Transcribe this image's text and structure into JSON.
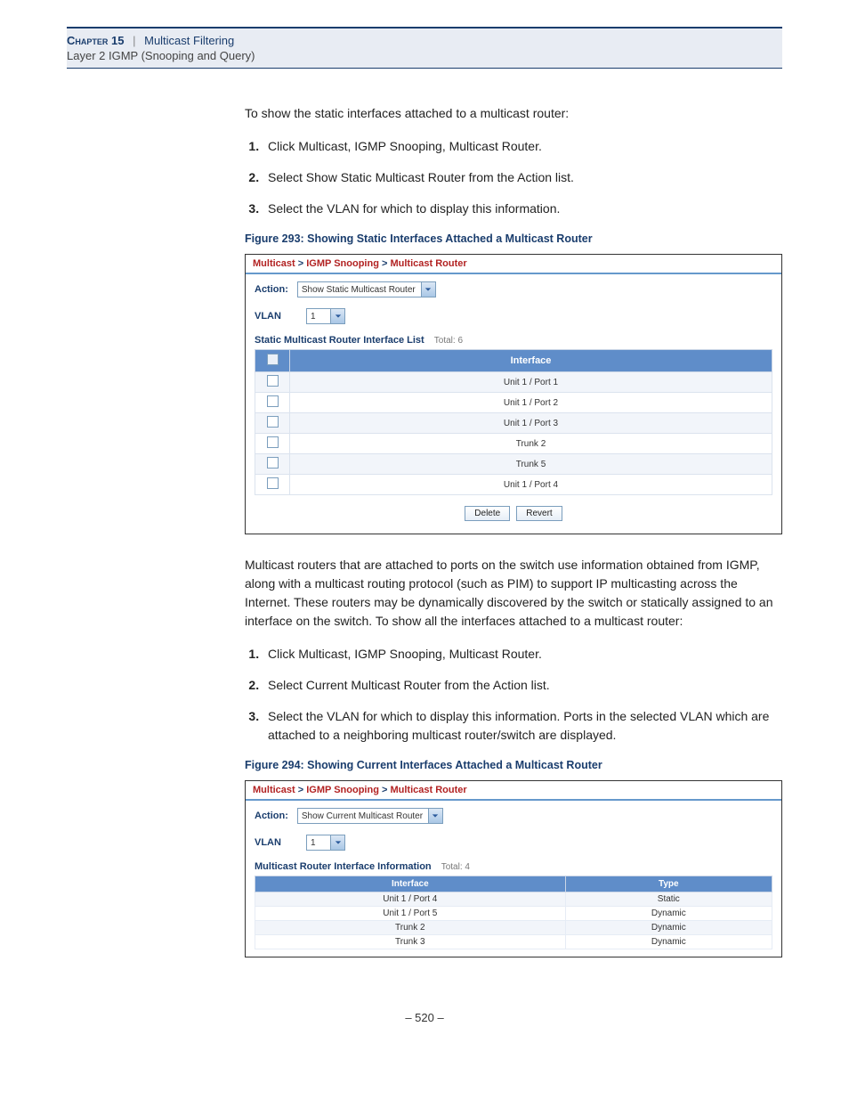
{
  "header": {
    "chapter": "Chapter 15",
    "section": "Multicast Filtering",
    "sub": "Layer 2 IGMP (Snooping and Query)"
  },
  "intro1": "To show the static interfaces attached to a multicast router:",
  "steps1": [
    "Click Multicast, IGMP Snooping, Multicast Router.",
    "Select Show Static Multicast Router from the Action list.",
    "Select the VLAN for which to display this information."
  ],
  "fig1_caption": "Figure 293:  Showing Static Interfaces Attached a Multicast Router",
  "screenshot1": {
    "breadcrumb": [
      "Multicast",
      "IGMP Snooping",
      "Multicast Router"
    ],
    "action_label": "Action:",
    "action_value": "Show Static Multicast Router",
    "vlan_label": "VLAN",
    "vlan_value": "1",
    "list_title": "Static Multicast Router Interface List",
    "total_label": "Total: 6",
    "col_interface": "Interface",
    "rows": [
      "Unit 1 / Port 1",
      "Unit 1 / Port 2",
      "Unit 1 / Port 3",
      "Trunk 2",
      "Trunk 5",
      "Unit 1 / Port 4"
    ],
    "btn_delete": "Delete",
    "btn_revert": "Revert"
  },
  "para2": "Multicast routers that are attached to ports on the switch use information obtained from IGMP, along with a multicast routing protocol (such as PIM) to support IP multicasting across the Internet. These routers may be dynamically discovered by the switch or statically assigned to an interface on the switch. To show all the interfaces attached to a multicast router:",
  "steps2": [
    "Click Multicast, IGMP Snooping, Multicast Router.",
    "Select Current Multicast Router from the Action list.",
    "Select the VLAN for which to display this information. Ports in the selected VLAN which are attached to a neighboring multicast router/switch are displayed."
  ],
  "fig2_caption": "Figure 294:  Showing Current Interfaces Attached a Multicast Router",
  "screenshot2": {
    "breadcrumb": [
      "Multicast",
      "IGMP Snooping",
      "Multicast Router"
    ],
    "action_label": "Action:",
    "action_value": "Show Current Multicast Router",
    "vlan_label": "VLAN",
    "vlan_value": "1",
    "list_title": "Multicast Router Interface Information",
    "total_label": "Total: 4",
    "col_interface": "Interface",
    "col_type": "Type",
    "rows": [
      {
        "if": "Unit 1 / Port 4",
        "type": "Static"
      },
      {
        "if": "Unit 1 / Port 5",
        "type": "Dynamic"
      },
      {
        "if": "Trunk 2",
        "type": "Dynamic"
      },
      {
        "if": "Trunk 3",
        "type": "Dynamic"
      }
    ]
  },
  "pagenum": "–  520  –"
}
